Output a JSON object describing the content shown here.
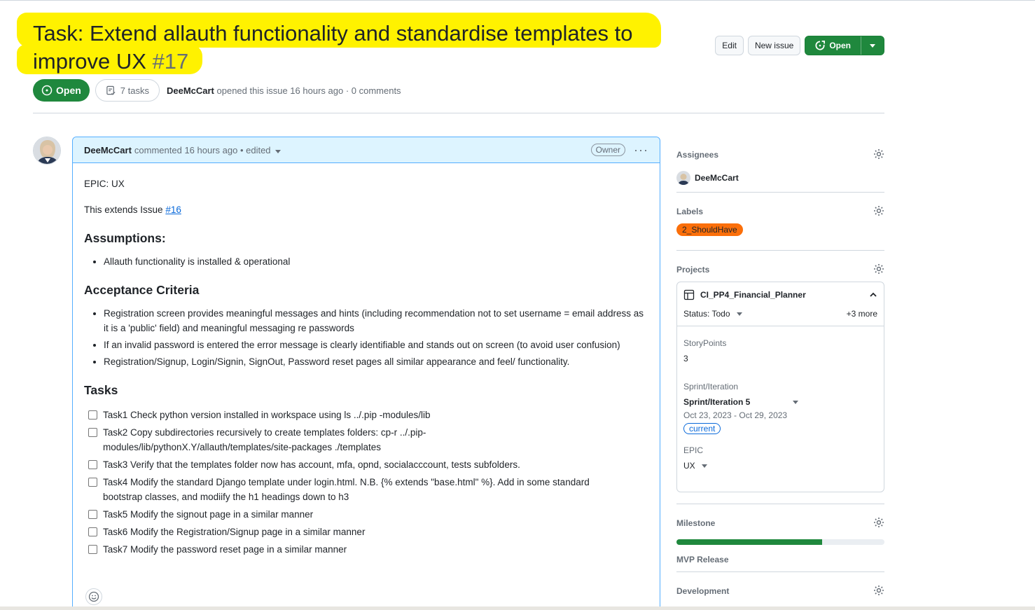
{
  "header": {
    "title": "Task: Extend allauth functionality and standardise templates to improve UX",
    "number": "#17",
    "edit_label": "Edit",
    "new_issue_label": "New issue",
    "open_button_label": "Open"
  },
  "meta": {
    "state": "Open",
    "tasks": "7 tasks",
    "author": "DeeMcCart",
    "opened_text": "opened this issue 16 hours ago · 0 comments"
  },
  "comment": {
    "author": "DeeMcCart",
    "header_text": "commented 16 hours ago • edited",
    "role": "Owner",
    "epic_line": "EPIC: UX",
    "extends_prefix": "This extends Issue",
    "extends_link": "#16",
    "assumptions_heading": "Assumptions:",
    "assumptions": [
      "Allauth functionality is installed & operational"
    ],
    "criteria_heading": "Acceptance Criteria",
    "criteria": [
      "Registration screen provides meaningful messages and hints (including recommendation not to set username = email address as it is a 'public' field) and meaningful messaging re passwords",
      "If an invalid password is entered the error message is clearly identifiable and stands out on screen (to avoid user confusion)",
      "Registration/Signup, Login/Signin, SignOut, Password reset pages all similar appearance and feel/ functionality."
    ],
    "tasks_heading": "Tasks",
    "tasks": [
      "Task1 Check python version installed in workspace using ls ../.pip -modules/lib",
      "Task2 Copy subdirectories recursively to create templates folders: cp-r ../.pip-modules/lib/pythonX.Y/allauth/templates/site-packages ./templates",
      "Task3 Verify that the templates folder now has account, mfa, opnd, socialacccount, tests subfolders.",
      "Task4 Modify the standard Django template under login.html. N.B. {% extends \"base.html\" %}. Add in some standard bootstrap classes, and modiify the h1 headings down to h3",
      "Task5 Modify the signout page in a similar manner",
      "Task6 Modify the Registration/Signup page in a similar manner",
      "Task7 Modify the password reset page in a similar manner"
    ]
  },
  "sidebar": {
    "assignees_title": "Assignees",
    "assignee": "DeeMcCart",
    "labels_title": "Labels",
    "label": "2_ShouldHave",
    "label_color": "#fb6f0a",
    "projects_title": "Projects",
    "project_name": "CI_PP4_Financial_Planner",
    "status": "Status: Todo",
    "more": "+3 more",
    "storypoints_label": "StoryPoints",
    "storypoints_value": "3",
    "sprint_label": "Sprint/Iteration",
    "sprint_value": "Sprint/Iteration 5",
    "sprint_dates": "Oct 23, 2023 - Oct 29, 2023",
    "sprint_badge": "current",
    "epic_label": "EPIC",
    "epic_value": "UX",
    "milestone_title": "Milestone",
    "milestone_progress": 0.7,
    "milestone_name": "MVP Release",
    "development_title": "Development"
  },
  "colors": {
    "green": "#1f883d",
    "highlight": "#fff200",
    "accent_blue": "#0969da"
  }
}
